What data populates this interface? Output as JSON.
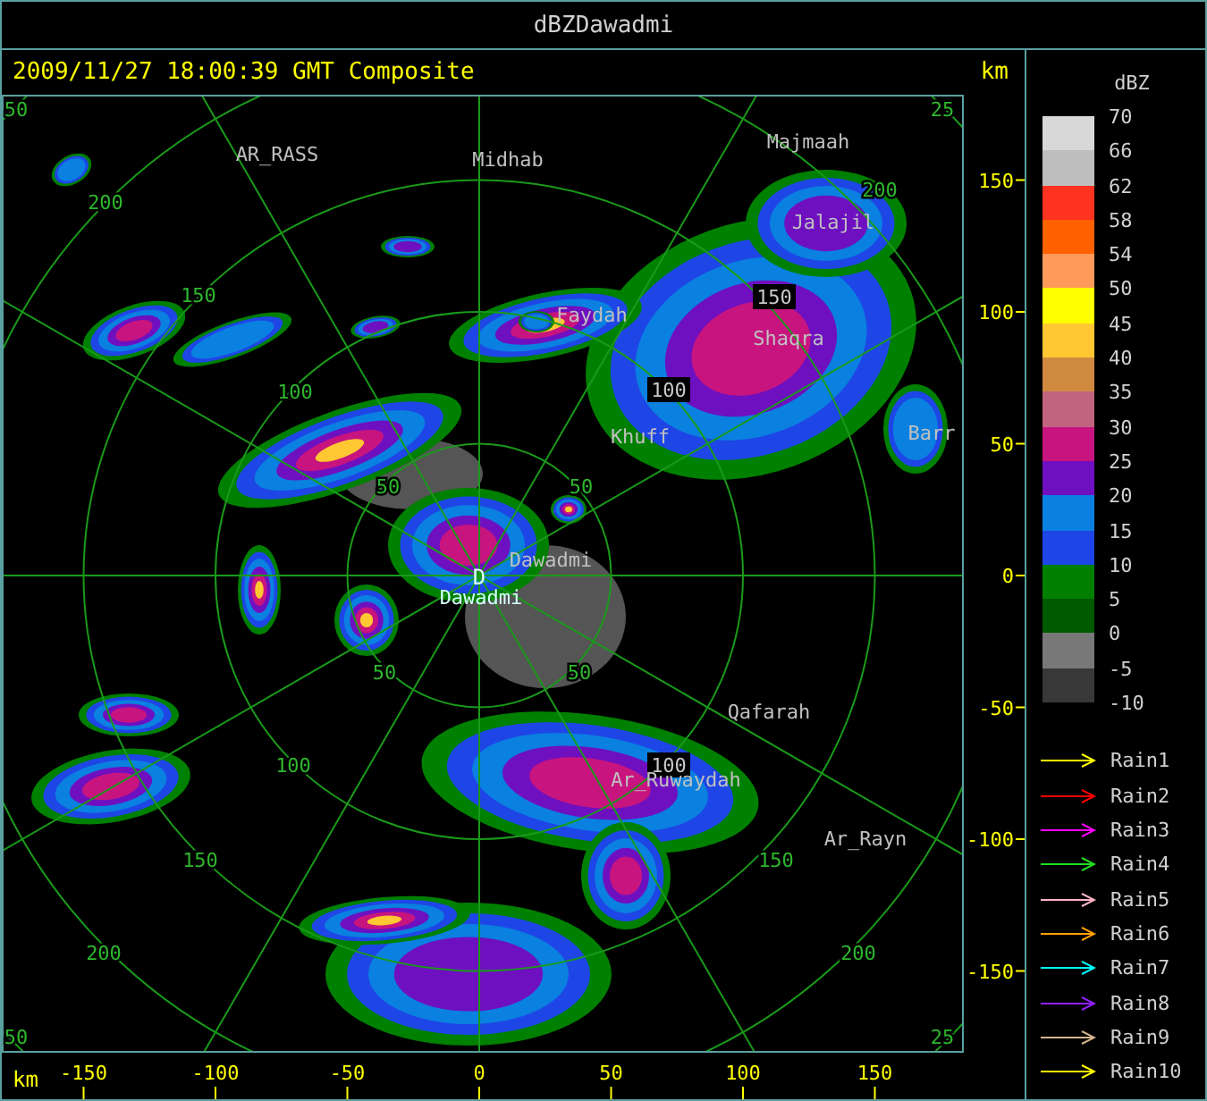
{
  "window": {
    "title": "dBZDawadmi"
  },
  "header": {
    "timestamp": "2009/11/27 18:00:39 GMT Composite",
    "unit": "km"
  },
  "map": {
    "site_marker": "D",
    "places": [
      {
        "name": "AR_RASS",
        "kind": "town"
      },
      {
        "name": "Midhab",
        "kind": "town"
      },
      {
        "name": "Majmaah",
        "kind": "town"
      },
      {
        "name": "Jalajil",
        "kind": "town"
      },
      {
        "name": "Faydah",
        "kind": "town"
      },
      {
        "name": "Shaqra",
        "kind": "town"
      },
      {
        "name": "Khuff",
        "kind": "town"
      },
      {
        "name": "Barr",
        "kind": "town"
      },
      {
        "name": "Dawadmi",
        "kind": "town"
      },
      {
        "name": "Dawadmi",
        "kind": "site"
      },
      {
        "name": "Qafarah",
        "kind": "town"
      },
      {
        "name": "Ar_Ruwaydah",
        "kind": "town"
      },
      {
        "name": "Ar_Rayn",
        "kind": "town"
      }
    ],
    "ring_labels": [
      {
        "text": "50",
        "kind": "plain"
      },
      {
        "text": "25",
        "kind": "plain"
      },
      {
        "text": "200",
        "kind": "plain"
      },
      {
        "text": "150",
        "kind": "plain"
      },
      {
        "text": "100",
        "kind": "plain"
      },
      {
        "text": "50",
        "kind": "plain"
      },
      {
        "text": "50",
        "kind": "plain"
      },
      {
        "text": "150",
        "kind": "boxed"
      },
      {
        "text": "100",
        "kind": "boxed"
      },
      {
        "text": "200",
        "kind": "plain"
      },
      {
        "text": "50",
        "kind": "plain"
      },
      {
        "text": "50",
        "kind": "plain"
      },
      {
        "text": "100",
        "kind": "plain"
      },
      {
        "text": "100",
        "kind": "boxed"
      },
      {
        "text": "150",
        "kind": "plain"
      },
      {
        "text": "150",
        "kind": "plain"
      },
      {
        "text": "200",
        "kind": "plain"
      },
      {
        "text": "200",
        "kind": "plain"
      },
      {
        "text": "50",
        "kind": "plain"
      },
      {
        "text": "25",
        "kind": "plain"
      }
    ]
  },
  "y_axis": {
    "ticks": [
      "150",
      "100",
      "50",
      "0",
      "-50",
      "-100",
      "-150"
    ]
  },
  "x_axis": {
    "unit": "km",
    "ticks": [
      "-150",
      "-100",
      "-50",
      "0",
      "50",
      "100",
      "150"
    ]
  },
  "legend": {
    "title": "dBZ",
    "bins": [
      {
        "label": "70",
        "color": "#d8d8d8"
      },
      {
        "label": "66",
        "color": "#bebebe"
      },
      {
        "label": "62",
        "color": "#ff3320"
      },
      {
        "label": "58",
        "color": "#ff6000"
      },
      {
        "label": "54",
        "color": "#ff9a5a"
      },
      {
        "label": "50",
        "color": "#ffff00"
      },
      {
        "label": "45",
        "color": "#ffc832"
      },
      {
        "label": "40",
        "color": "#d08a40"
      },
      {
        "label": "35",
        "color": "#c06480"
      },
      {
        "label": "30",
        "color": "#c8147f"
      },
      {
        "label": "25",
        "color": "#6e10c0"
      },
      {
        "label": "20",
        "color": "#0a80e0"
      },
      {
        "label": "15",
        "color": "#1e46e6"
      },
      {
        "label": "10",
        "color": "#008000"
      },
      {
        "label": "5",
        "color": "#005a00"
      },
      {
        "label": "0",
        "color": "#787878"
      },
      {
        "label": "-5",
        "color": "#383838"
      }
    ],
    "bottom_label": "-10",
    "tracks": [
      {
        "label": "Rain1",
        "color": "#ffff00"
      },
      {
        "label": "Rain2",
        "color": "#ff0000"
      },
      {
        "label": "Rain3",
        "color": "#ff00ff"
      },
      {
        "label": "Rain4",
        "color": "#20e020"
      },
      {
        "label": "Rain5",
        "color": "#ffb4c8"
      },
      {
        "label": "Rain6",
        "color": "#ffa000"
      },
      {
        "label": "Rain7",
        "color": "#00ffff"
      },
      {
        "label": "Rain8",
        "color": "#9020ff"
      },
      {
        "label": "Rain9",
        "color": "#d2b48c"
      },
      {
        "label": "Rain10",
        "color": "#ffff00"
      }
    ]
  }
}
